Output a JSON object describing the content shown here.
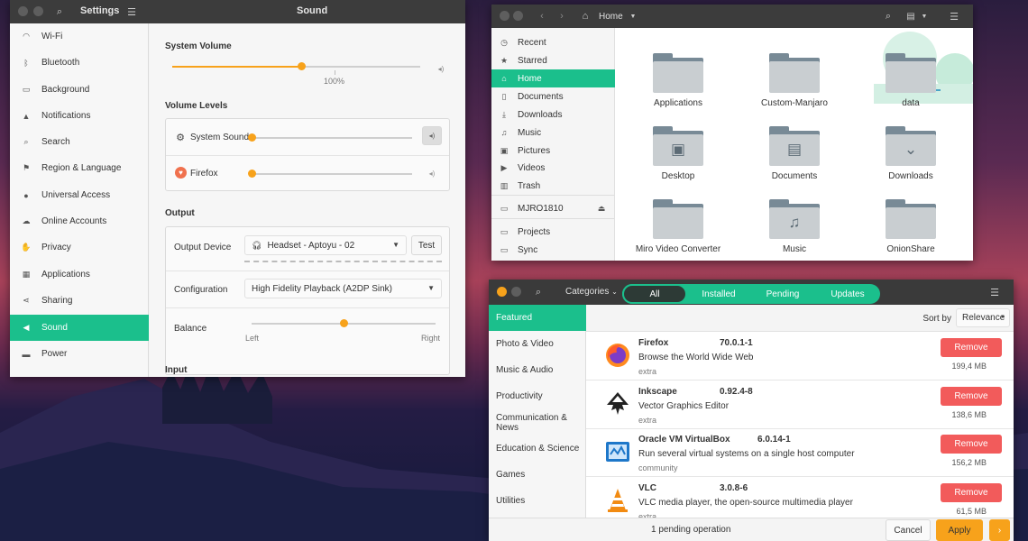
{
  "settings": {
    "title": "Settings",
    "panel_title": "Sound",
    "sidebar": [
      {
        "label": "Wi-Fi",
        "icon": "wifi-icon"
      },
      {
        "label": "Bluetooth",
        "icon": "bluetooth-icon"
      },
      {
        "label": "Background",
        "icon": "background-icon"
      },
      {
        "label": "Notifications",
        "icon": "bell-icon"
      },
      {
        "label": "Search",
        "icon": "search-icon"
      },
      {
        "label": "Region & Language",
        "icon": "flag-icon"
      },
      {
        "label": "Universal Access",
        "icon": "accessibility-icon"
      },
      {
        "label": "Online Accounts",
        "icon": "cloud-icon"
      },
      {
        "label": "Privacy",
        "icon": "hand-icon"
      },
      {
        "label": "Applications",
        "icon": "grid-icon"
      },
      {
        "label": "Sharing",
        "icon": "share-icon"
      },
      {
        "label": "Sound",
        "icon": "speaker-icon",
        "active": true
      },
      {
        "label": "Power",
        "icon": "power-icon"
      }
    ],
    "sound": {
      "system_volume_heading": "System Volume",
      "system_volume_value": 0.52,
      "system_volume_mark": "100%",
      "volume_levels_heading": "Volume Levels",
      "levels": [
        {
          "label": "System Sounds",
          "value": 0.0
        },
        {
          "label": "Firefox",
          "value": 0.0
        }
      ],
      "output_heading": "Output",
      "output_device_label": "Output Device",
      "output_device_value": "Headset - Aptoyu  -  02",
      "test_label": "Test",
      "configuration_label": "Configuration",
      "configuration_value": "High Fidelity Playback (A2DP Sink)",
      "balance_label": "Balance",
      "balance_value": 0.5,
      "balance_left": "Left",
      "balance_right": "Right",
      "input_heading": "Input"
    }
  },
  "files": {
    "path": "Home",
    "sidebar": [
      {
        "label": "Recent",
        "icon": "clock-icon"
      },
      {
        "label": "Starred",
        "icon": "star-icon"
      },
      {
        "label": "Home",
        "icon": "home-icon",
        "active": true
      },
      {
        "label": "Documents",
        "icon": "document-icon"
      },
      {
        "label": "Downloads",
        "icon": "download-icon"
      },
      {
        "label": "Music",
        "icon": "music-icon"
      },
      {
        "label": "Pictures",
        "icon": "picture-icon"
      },
      {
        "label": "Videos",
        "icon": "video-icon"
      },
      {
        "label": "Trash",
        "icon": "trash-icon"
      },
      {
        "label": "MJRO1810",
        "icon": "drive-icon"
      },
      {
        "label": "Projects",
        "icon": "folder-icon"
      },
      {
        "label": "Sync",
        "icon": "folder-icon"
      }
    ],
    "folders": [
      {
        "label": "Applications",
        "emblem": ""
      },
      {
        "label": "Custom-Manjaro",
        "emblem": ""
      },
      {
        "label": "data",
        "emblem": ""
      },
      {
        "label": "Desktop",
        "emblem": "▣"
      },
      {
        "label": "Documents",
        "emblem": "▤"
      },
      {
        "label": "Downloads",
        "emblem": "⌄"
      },
      {
        "label": "Miro Video Converter",
        "emblem": ""
      },
      {
        "label": "Music",
        "emblem": "♫"
      },
      {
        "label": "OnionShare",
        "emblem": ""
      }
    ]
  },
  "software": {
    "categories_label": "Categories",
    "tabs": [
      "All",
      "Installed",
      "Pending",
      "Updates"
    ],
    "active_tab": "All",
    "sidebar": [
      "Featured",
      "Photo & Video",
      "Music & Audio",
      "Productivity",
      "Communication & News",
      "Education & Science",
      "Games",
      "Utilities"
    ],
    "sort_label": "Sort by",
    "sort_value": "Relevance",
    "apps": [
      {
        "name": "Firefox",
        "version": "70.0.1-1",
        "description": "Browse the World Wide Web",
        "repo": "extra",
        "size": "199,4 MB",
        "action": "Remove",
        "icon": "firefox-icon",
        "color": "#ff6a2b"
      },
      {
        "name": "Inkscape",
        "version": "0.92.4-8",
        "description": "Vector Graphics Editor",
        "repo": "extra",
        "size": "138,6 MB",
        "action": "Remove",
        "icon": "inkscape-icon",
        "color": "#222222"
      },
      {
        "name": "Oracle VM VirtualBox",
        "version": "6.0.14-1",
        "description": "Run several virtual systems on a single host computer",
        "repo": "community",
        "size": "156,2 MB",
        "action": "Remove",
        "icon": "virtualbox-icon",
        "color": "#1e77c9"
      },
      {
        "name": "VLC",
        "version": "3.0.8-6",
        "description": "VLC media player, the open-source multimedia player",
        "repo": "extra",
        "size": "61,5 MB",
        "action": "Remove",
        "icon": "vlc-icon",
        "color": "#f28b12"
      }
    ],
    "pending": "1 pending operation",
    "cancel_label": "Cancel",
    "apply_label": "Apply"
  },
  "colors": {
    "accent": "#1bbf8c",
    "slider": "#f7a21b",
    "danger": "#f25b5b",
    "titlebar": "#3c3c3c"
  }
}
